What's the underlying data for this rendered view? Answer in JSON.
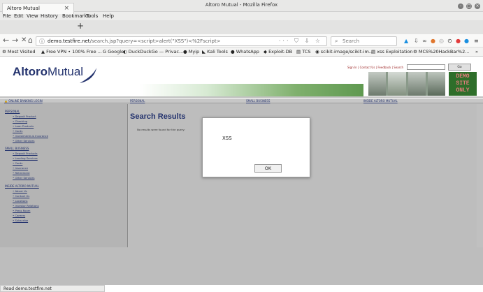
{
  "window": {
    "title": "Altoro Mutual - Mozilla Firefox"
  },
  "menubar": [
    "File",
    "Edit",
    "View",
    "History",
    "Bookmarks",
    "Tools",
    "Help"
  ],
  "tab": {
    "label": "Altoro Mutual",
    "close": "×",
    "new": "+"
  },
  "nav": {
    "back": "←",
    "forward": "→",
    "reload": "✕",
    "home": "⌂",
    "url_domain": "demo.testfire.net",
    "url_rest": "/search.jsp?query=<script>alert(\"XSS\")<%2Fscript>",
    "url_actions": "··· ⛉ ⇩ ☆",
    "search_placeholder": "Search"
  },
  "bookmarks": [
    "⚙ Most Visited",
    "▲ Free VPN • 100% Free ...",
    "G Google",
    "◐ DuckDuckGo — Privac...",
    "● Myip",
    "◣ Kali Tools",
    "● WhatsApp",
    "◆ Exploit-DB",
    "▤ TCS",
    "◉ scikit-image/scikit-im...",
    "▤ xss Exploitation",
    "⚙ MCS%20HackBar%2...",
    "»"
  ],
  "site": {
    "logo_bold": "Altoro",
    "logo_rest": "Mutual",
    "top_links": "Sign In | Contact Us | Feedback | Search",
    "go": "Go",
    "demo_lines": [
      "DEMO",
      "SITE",
      "ONLY"
    ],
    "nav_row": [
      "🔒 ONLINE BANKING LOGIN",
      "PERSONAL",
      "SMALL BUSINESS",
      "INSIDE ALTORO MUTUAL"
    ],
    "sections": [
      {
        "title": "PERSONAL",
        "items": [
          "Deposit Product",
          "Checking",
          "Loan Products",
          "Cards",
          "Investments & Insurance",
          "Other Services"
        ]
      },
      {
        "title": "SMALL BUSINESS",
        "items": [
          "Deposit Products",
          "Lending Services",
          "Cards",
          "Insurance",
          "Retirement",
          "Other Services"
        ]
      },
      {
        "title": "INSIDE ALTORO MUTUAL",
        "items": [
          "About Us",
          "Contact Us",
          "Locations",
          "Investor Relations",
          "Press Room",
          "Careers",
          "Subscribe"
        ]
      }
    ],
    "results_title": "Search Results",
    "results_msg": "No results were found for the query:"
  },
  "dialog": {
    "message": "XSS",
    "ok": "OK"
  },
  "status": "Read demo.testfire.net"
}
